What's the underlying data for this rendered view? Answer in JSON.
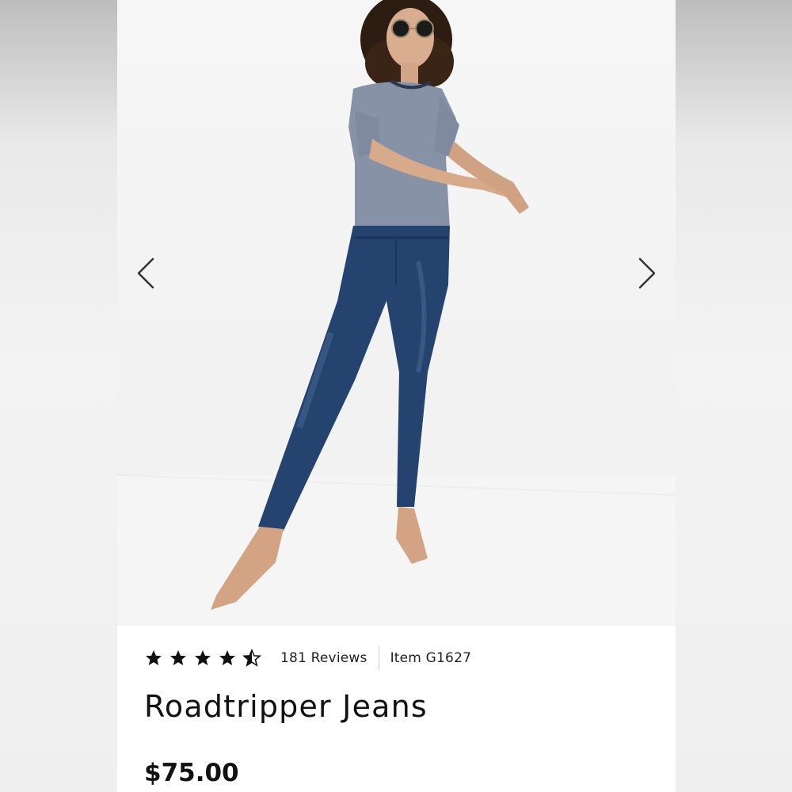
{
  "gallery": {
    "prev_icon": "chevron-left-icon",
    "next_icon": "chevron-right-icon",
    "image_subject": "model wearing jeans"
  },
  "product": {
    "rating": 4.5,
    "rating_max": 5,
    "reviews_label": "181 Reviews",
    "item_label": "Item G1627",
    "name": "Roadtripper Jeans",
    "price": "$75.00"
  },
  "colors": {
    "denim": "#24446f",
    "tee": "#8792a6",
    "text": "#111111"
  }
}
